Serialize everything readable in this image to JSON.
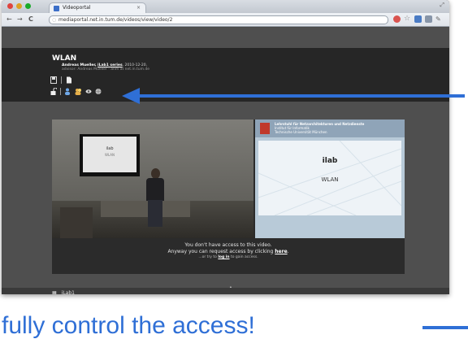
{
  "browser": {
    "tab_title": "Videoportal",
    "tab_close": "×",
    "url": "mediaportal.net.in.tum.de/videos/view/video/2",
    "nav_back": "←",
    "nav_forward": "→",
    "nav_reload": "C"
  },
  "header": {
    "title": "WLAN",
    "author_prefix": "Andreas Mueller,",
    "course": "iLab1 series",
    "author_suffix": ", 2010-12-20,",
    "advisor": "advisor: Andreas Mueller - anm at net.in.tum.de"
  },
  "slide": {
    "header_line1": "Lehrstuhl für Netzarchitekturen und Netzdienste",
    "header_line2": "Institut für Informatik",
    "header_line3": "Technische Universität München",
    "title": "ilab",
    "subtitle": "WLAN"
  },
  "video_screen": {
    "title": "ilab",
    "subtitle": "WLAN"
  },
  "notice": {
    "line1": "You don't have access to this video.",
    "line2_prefix": "Anyway you can request access by clicking ",
    "line2_link": "here",
    "line2_suffix": ".",
    "line3_prefix": "...or try to ",
    "line3_link": "log in",
    "line3_suffix": " to gain access."
  },
  "footer": {
    "caret": "▲",
    "item": "iLab1"
  },
  "caption": "fully control the access!",
  "colors": {
    "arrow": "#2f6fd6",
    "page_bg": "#4f4f4f",
    "header_bg": "#262626"
  }
}
